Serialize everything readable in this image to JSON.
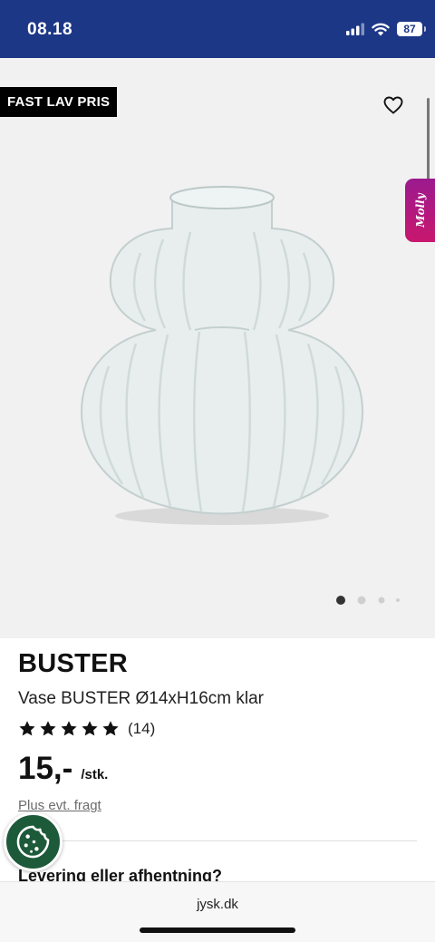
{
  "status_bar": {
    "time": "08.18",
    "battery": "87"
  },
  "gallery": {
    "badge": "FAST LAV PRIS",
    "molly_label": "Molly",
    "slides_total": 4,
    "active_slide": 1
  },
  "product": {
    "name": "BUSTER",
    "description": "Vase BUSTER Ø14xH16cm klar",
    "rating_stars": 5,
    "review_count": "(14)",
    "price": "15,-",
    "unit": "/stk.",
    "shipping_note": "Plus evt. fragt"
  },
  "sections": {
    "delivery_heading": "Levering eller afhentning?"
  },
  "browser": {
    "url": "jysk.dk"
  },
  "colors": {
    "header": "#1d3787",
    "molly": "#b0177f",
    "cookie": "#1d5a3a"
  }
}
